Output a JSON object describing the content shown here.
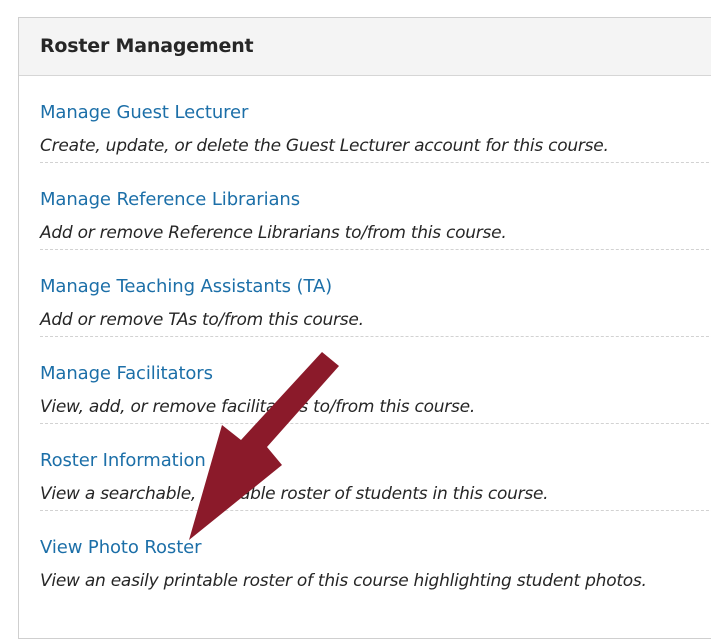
{
  "panel": {
    "title": "Roster Management"
  },
  "items": [
    {
      "link": "Manage Guest Lecturer",
      "description": "Create, update, or delete the Guest Lecturer account for this course."
    },
    {
      "link": "Manage Reference Librarians",
      "description": "Add or remove Reference Librarians to/from this course."
    },
    {
      "link": "Manage Teaching Assistants (TA)",
      "description": "Add or remove TAs to/from this course."
    },
    {
      "link": "Manage Facilitators",
      "description": "View, add, or remove facilitators to/from this course."
    },
    {
      "link": "Roster Information",
      "description": "View a searchable, printable roster of students in this course."
    },
    {
      "link": "View Photo Roster",
      "description": "View an easily printable roster of this course highlighting student photos."
    }
  ],
  "annotation": {
    "icon": "arrow-icon",
    "color": "#8b1a2a"
  }
}
